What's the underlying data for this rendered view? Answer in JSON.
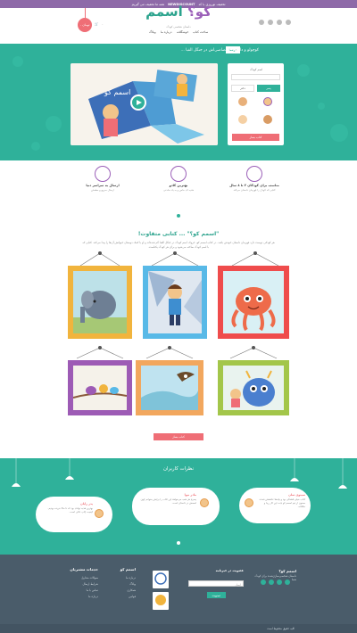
{
  "promo": {
    "prefix": "تخفیف نوروزی با کد",
    "code": "NEWDISCOUNT",
    "suffix": "همه ما تخفیف می گیریم"
  },
  "header": {
    "logo": {
      "main": "اسمم",
      "accent": "کو؟"
    },
    "logo_sub": "داستان شخصی کودک",
    "nav": [
      "ساخت کتاب",
      "خوشگلانه",
      "درباره ما",
      "وبلاگ"
    ],
    "cart_count": "۰",
    "cart_amount": "۰ تومان"
  },
  "hero": {
    "title": "کوچولو و داستان اختصاصی‌اش در جنگل الفبا ...",
    "badge": "درسا",
    "form": {
      "name_label": "اسم کودک",
      "gender_boy": "پسر",
      "gender_girl": "دختر",
      "button": "کتاب بساز"
    }
  },
  "features": [
    {
      "title": "مناسب برای کودکان ۳ تا ۸ سال",
      "text": "کتابی که کودک را قهرمان داستان می‌کند"
    },
    {
      "title": "بهترین کادو",
      "text": "هدیه ای خاص و به یاد ماندنی"
    },
    {
      "title": "ارسال به سراسر دنیا",
      "text": "ارسال سریع و مطمئن"
    }
  ],
  "why": {
    "title": "\"اسمم کو؟\" ... کتابی متفاوت!",
    "text": "هر کودکی دوست دارد قهرمان داستان خودش باشد. در کتاب اسمم کو، حروف اسم کودک در جنگل الفبا گم شده‌اند و او با کمک دوستان حیوانش آن‌ها را پیدا می‌کند. کتابی که با اسم کودک ساخته می‌شود و برای هر کودک یکتاست."
  },
  "frames": {
    "colors": [
      "#ef4c4c",
      "#58b9e7",
      "#f1b43d",
      "#f2a75e",
      "#a3c64a",
      "#9d5bb5"
    ],
    "illustrations": [
      "octopus-illustration",
      "boy-illustration",
      "elephant-illustration",
      "monster-illustration",
      "eagle-illustration",
      "birds-illustration"
    ]
  },
  "buy_button": "کتاب بساز",
  "testimonials": {
    "title": "نظرات کاربران",
    "items": [
      {
        "name": "سینوی سان",
        "text": "کتاب خیلی قشنگی بود و بچه‌ها عاشقش شدند. ممنون از تیم اسمم کو بابت این کار زیبا و خلاقانه."
      },
      {
        "name": "مادر نیوا",
        "text": "پسرم هر شب می‌خواهد این کتاب را برایش بخوانم چون اسمش در داستان است."
      },
      {
        "name": "پدر رایان",
        "text": "بهترین هدیه تولدی بود که تا حالا خریده بودیم. کیفیت چاپ عالی است."
      }
    ]
  },
  "footer": {
    "about_title": "اسمم کو؟",
    "about_text": "داستان شخصی‌سازی‌شده برای کودک شما",
    "news_title": "عضویت در خبرنامه",
    "news_placeholder": "ایمیل",
    "news_button": "عضویت",
    "services_title": "خدمات مشتریان",
    "services": [
      "سوالات متداول",
      "شرایط ارسال",
      "تماس با ما",
      "درباره ما"
    ],
    "links_title": "اسمم کو",
    "links": [
      "درباره ما",
      "وبلاگ",
      "همکاری",
      "قوانین"
    ],
    "copyright": "کلیه حقوق محفوظ است"
  }
}
